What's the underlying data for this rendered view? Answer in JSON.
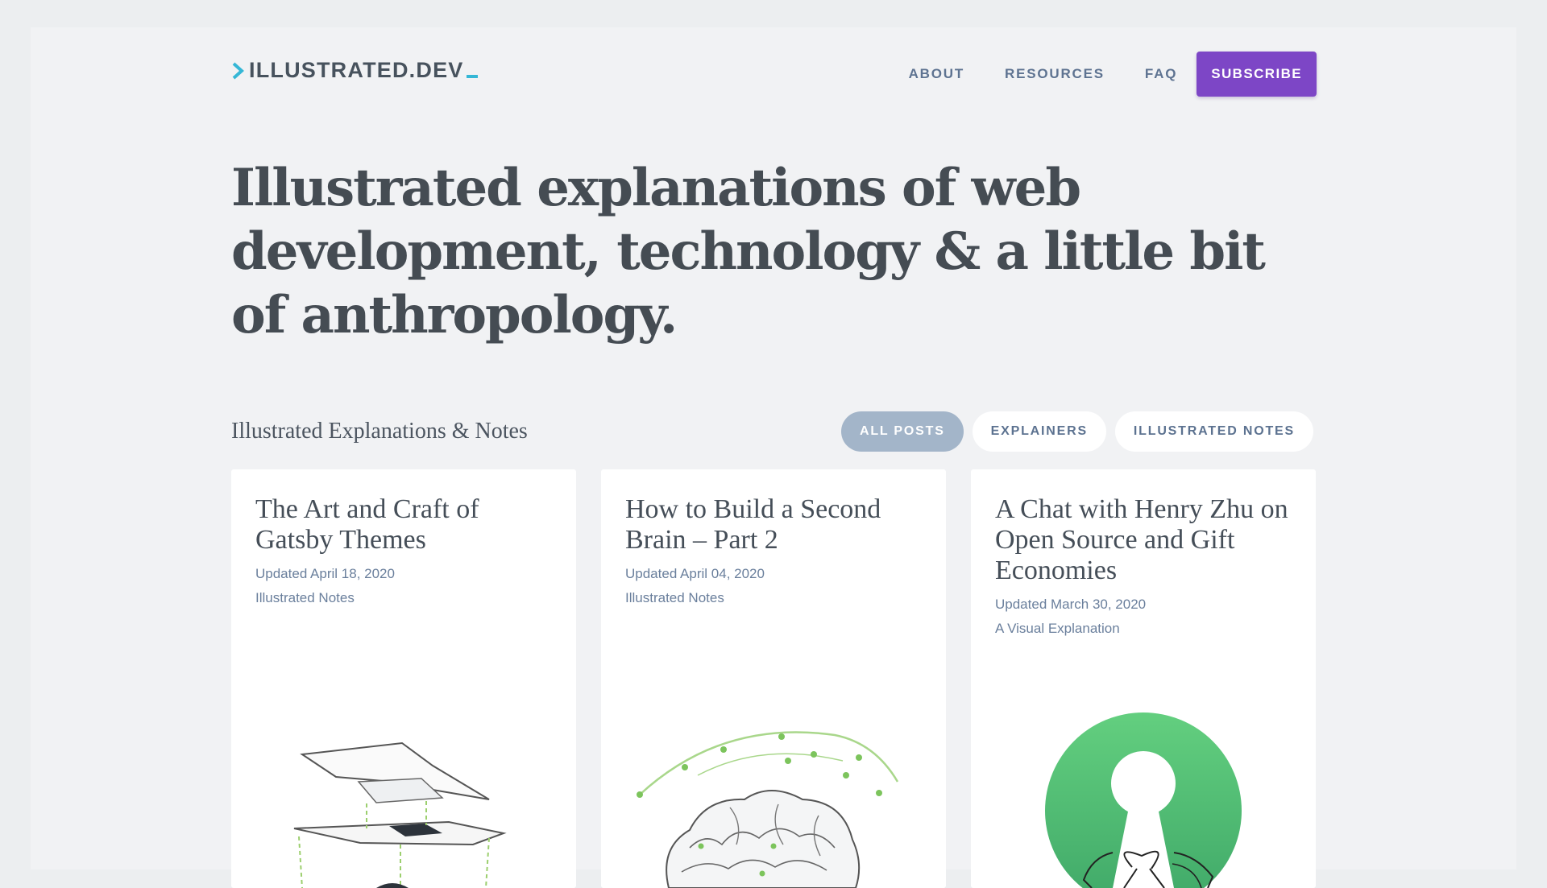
{
  "header": {
    "logo_text": "ILLUSTRATED.DEV",
    "nav": [
      "ABOUT",
      "RESOURCES",
      "FAQ"
    ],
    "subscribe_label": "SUBSCRIBE"
  },
  "hero": {
    "headline": "Illustrated explanations of web development, technology & a little bit of anthropology."
  },
  "section": {
    "title": "Illustrated Explanations & Notes",
    "filters": [
      {
        "label": "ALL POSTS",
        "active": true
      },
      {
        "label": "EXPLAINERS",
        "active": false
      },
      {
        "label": "ILLUSTRATED NOTES",
        "active": false
      }
    ]
  },
  "cards": [
    {
      "title": "The Art and Craft of Gatsby Themes",
      "date": "Updated April 18, 2020",
      "category": "Illustrated Notes",
      "illustration": "stacked-layers-illustration"
    },
    {
      "title": "How to Build a Second Brain – Part 2",
      "date": "Updated April 04, 2020",
      "category": "Illustrated Notes",
      "illustration": "brain-illustration"
    },
    {
      "title": "A Chat with Henry Zhu on Open Source and Gift Economies",
      "date": "Updated March 30, 2020",
      "category": "A Visual Explanation",
      "illustration": "open-source-gift-illustration"
    }
  ],
  "colors": {
    "accent_purple": "#7d46c6",
    "logo_cyan": "#35b7d6",
    "active_pill": "#a3b5c9",
    "illustration_green": "#59c47a"
  }
}
